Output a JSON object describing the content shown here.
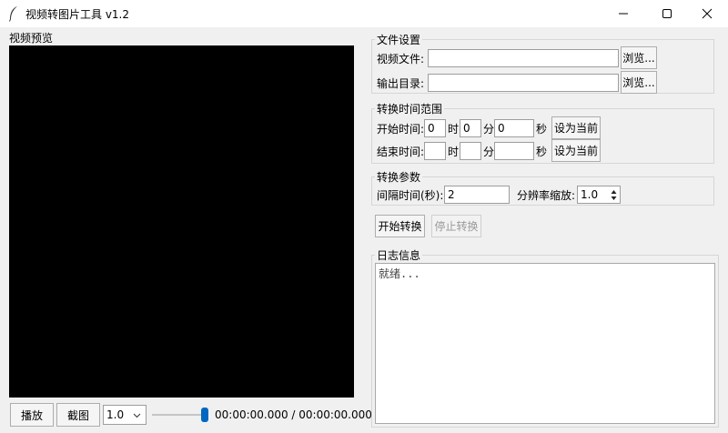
{
  "window": {
    "title": "视频转图片工具 v1.2",
    "minimize_icon": "minimize-icon",
    "maximize_icon": "maximize-icon",
    "close_icon": "close-icon"
  },
  "preview": {
    "group_label": "视频预览",
    "play_label": "播放",
    "screenshot_label": "截图",
    "speed_value": "1.0",
    "progress_fraction": 1.0,
    "time_display": "00:00:00.000 / 00:00:00.000"
  },
  "file_settings": {
    "group_label": "文件设置",
    "video_file_label": "视频文件:",
    "video_file_value": "",
    "output_dir_label": "输出目录:",
    "output_dir_value": "",
    "browse_label": "浏览..."
  },
  "time_range": {
    "group_label": "转换时间范围",
    "start_label": "开始时间:",
    "start_hour": "0",
    "start_min": "0",
    "start_sec": "0",
    "end_label": "结束时间:",
    "end_hour": "",
    "end_min": "",
    "end_sec": "",
    "hour_unit": "时",
    "min_unit": "分",
    "sec_unit": "秒",
    "set_current_label": "设为当前"
  },
  "params": {
    "group_label": "转换参数",
    "interval_label": "间隔时间(秒):",
    "interval_value": "2",
    "scale_label": "分辨率缩放:",
    "scale_value": "1.0"
  },
  "actions": {
    "start_label": "开始转换",
    "stop_label": "停止转换"
  },
  "log": {
    "group_label": "日志信息",
    "text": "就绪..."
  }
}
